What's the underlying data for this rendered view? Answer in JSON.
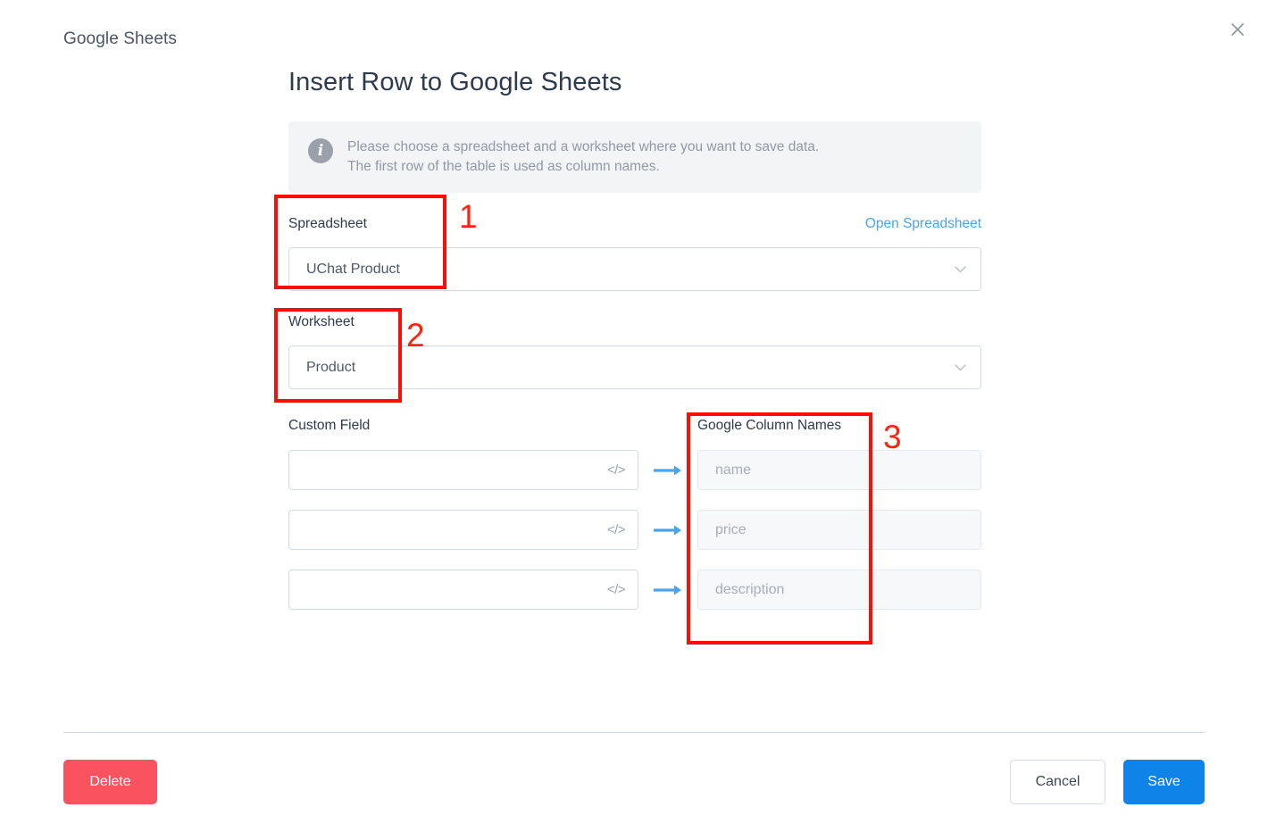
{
  "window": {
    "title": "Google Sheets",
    "close_icon": "close-icon"
  },
  "main": {
    "heading": "Insert Row to Google Sheets",
    "notice": {
      "icon": "info-icon",
      "line1": "Please choose a spreadsheet and a worksheet where you want to save data.",
      "line2": "The first row of the table is used as column names."
    },
    "spreadsheet": {
      "label": "Spreadsheet",
      "open_link": "Open Spreadsheet",
      "value": "UChat Product",
      "chevron_icon": "chevron-down-icon"
    },
    "worksheet": {
      "label": "Worksheet",
      "value": "Product",
      "chevron_icon": "chevron-down-icon"
    },
    "mapping": {
      "left_header": "Custom Field",
      "right_header": "Google Column Names",
      "code_icon": "code-icon",
      "arrow_icon": "arrow-right-icon",
      "rows": [
        {
          "custom_field_value": "",
          "custom_field_placeholder": "",
          "column_name": "name"
        },
        {
          "custom_field_value": "",
          "custom_field_placeholder": "",
          "column_name": "price"
        },
        {
          "custom_field_value": "",
          "custom_field_placeholder": "",
          "column_name": "description"
        }
      ]
    }
  },
  "footer": {
    "delete_label": "Delete",
    "cancel_label": "Cancel",
    "save_label": "Save"
  },
  "annotations": {
    "one": "1",
    "two": "2",
    "three": "3"
  },
  "colors": {
    "annotation_red": "#fa0f08",
    "link_blue": "#4da3e8",
    "save_blue": "#1083e8",
    "delete_red": "#f9535f",
    "arrow_blue": "#4da3e8"
  }
}
